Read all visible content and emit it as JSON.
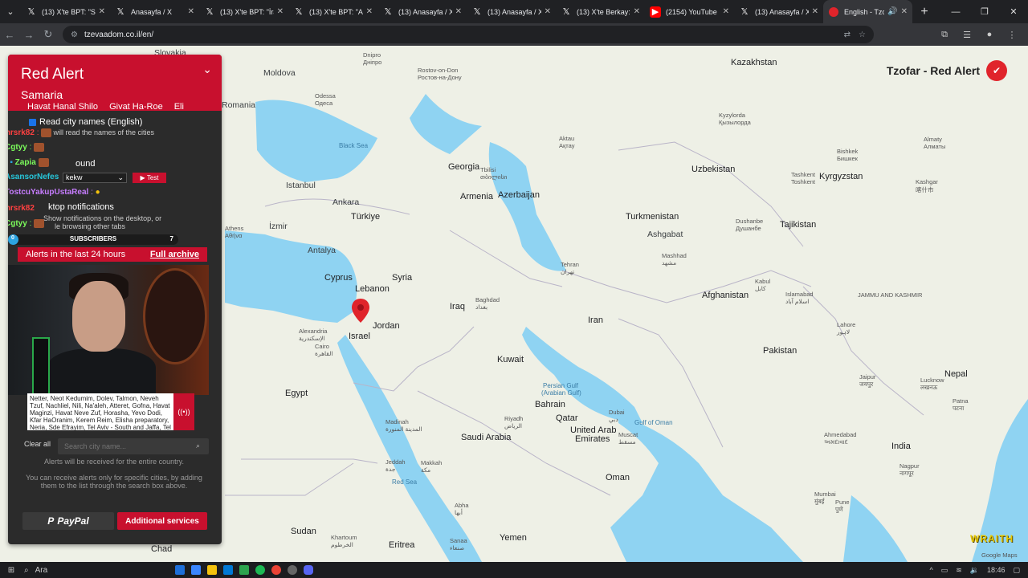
{
  "browser": {
    "tabs": [
      {
        "label": "(13) X'te BPT: \"SO",
        "icon": "x-icon"
      },
      {
        "label": "Anasayfa / X",
        "icon": "x-icon"
      },
      {
        "label": "(13) X'te BPT: \"İra",
        "icon": "x-icon"
      },
      {
        "label": "(13) X'te BPT: \"AB",
        "icon": "x-icon"
      },
      {
        "label": "(13) Anasayfa / X",
        "icon": "x-icon"
      },
      {
        "label": "(13) Anasayfa / X",
        "icon": "x-icon"
      },
      {
        "label": "(13) X'te Berkay: \"",
        "icon": "x-icon"
      },
      {
        "label": "(2154) YouTube",
        "icon": "youtube-icon"
      },
      {
        "label": "(13) Anasayfa / X",
        "icon": "x-icon"
      },
      {
        "label": "English - Tzofa",
        "icon": "tzofar-icon",
        "active": true
      }
    ],
    "url": "tzevaadom.co.il/en/"
  },
  "panel": {
    "title": "Red Alert",
    "region": "Samaria",
    "cities": [
      "Havat Hanal Shilo",
      "Givat Ha-Roe",
      "Eli"
    ],
    "read_names_label": "Read city names (English)",
    "read_names_desc": "rts will read the names of the cities",
    "sound_label": "ound",
    "sound_value": "kekw",
    "test_label": "Test",
    "desktop_label": "ktop notifications",
    "desktop_desc1": "Show notifications on the desktop, or",
    "desktop_desc2": "le browsing other tabs",
    "alerts_24h": "Alerts in the last 24 hours",
    "full_archive": "Full archive",
    "alert_text": "Netter, Neot Kedumim, Dolev, Talmon, Neveh Tzuf, Nachliel, Nili, Na'aleh, Atteret, Gofna, Havat Maginzi, Havat Neve Zuf, Horasha, Yevo Dodi, Kfar HaOranim, Kerem Reim, Elisha preparatory, Neria, Sde Efrayim, Tel Aviv - South and Jaffa, Tel Aviv - East, Azor, Givat",
    "clear_all": "Clear all",
    "search_placeholder": "Search city name...",
    "note1": "Alerts will be received for the entire country.",
    "note2": "You can receive alerts only for specific cities, by adding them to the list through the search box above.",
    "paypal": "PayPal",
    "services": "Additional services"
  },
  "chat": [
    {
      "name": "mrsrk82",
      "text": "",
      "color": "#ff4040"
    },
    {
      "name": "Cgtyy",
      "text": ":",
      "color": "#7cfc5c"
    },
    {
      "name": "Zapia",
      "text": "",
      "color": "#7cfc5c"
    },
    {
      "name": "AsansorNefes",
      "text": ": kekw",
      "color": "#26c6da"
    },
    {
      "name": "TostcuYakupUstaReal",
      "text": ":",
      "color": "#c77dff"
    },
    {
      "name": "mrsrk82",
      "text": "",
      "color": "#ff4040"
    },
    {
      "name": "Cgtyy",
      "text": ":",
      "color": "#7cfc5c"
    }
  ],
  "subs": {
    "label": "SUBSCRIBERS",
    "count": "7",
    "start": "0"
  },
  "brand": {
    "title": "Tzofar - Red Alert"
  },
  "map_labels": {
    "slovakia": "Slovakia",
    "moldova": "Moldova",
    "dnipro": "Dnipro",
    "dnipro_local": "Дніпро",
    "rostov": "Rostov-on-Don",
    "rostov_local": "Ростов-на-Дону",
    "kazakhstan": "Kazakhstan",
    "romania": "Romania",
    "odessa": "Odessa",
    "odessa_local": "Одеса",
    "black_sea": "Black Sea",
    "aktau": "Aktau",
    "aktau_local": "Ақтау",
    "kyzylorda": "Kyzylorda",
    "kyzylorda_local": "Қызылорда",
    "bishkek": "Bishkek",
    "bishkek_local": "Бишкек",
    "almaty": "Almaty",
    "almaty_local": "Алматы",
    "uzbekistan": "Uzbekistan",
    "kyrgyzstan": "Kyrgyzstan",
    "tashkent": "Tashkent",
    "tashkent_local": "Toshkent",
    "kashgar": "Kashgar",
    "kashgar_local": "喀什市",
    "istanbul": "Istanbul",
    "georgia": "Georgia",
    "tbilisi": "Tbilisi",
    "tbilisi_local": "თბილისი",
    "armenia": "Armenia",
    "azerbaijan": "Azerbaijan",
    "ankara": "Ankara",
    "turkiye": "Türkiye",
    "athens": "Athens",
    "athens_local": "Αθήνα",
    "izmir": "İzmir",
    "turkmenistan": "Turkmenistan",
    "ashgabat": "Ashgabat",
    "dushanbe": "Dushanbe",
    "dushanbe_local": "Душанбе",
    "tajikistan": "Tajikistan",
    "antalya": "Antalya",
    "mashhad": "Mashhad",
    "mashhad_local": "مشهد",
    "tehran": "Tehran",
    "tehran_local": "تهران",
    "cyprus": "Cyprus",
    "syria": "Syria",
    "lebanon": "Lebanon",
    "iraq": "Iraq",
    "baghdad": "Baghdad",
    "baghdad_local": "بغداد",
    "afghanistan": "Afghanistan",
    "kabul": "Kabul",
    "kabul_local": "کابل",
    "islamabad": "Islamabad",
    "islamabad_local": "اسلام آباد",
    "jammu": "JAMMU AND KASHMIR",
    "alexandria": "Alexandria",
    "alexandria_local": "الإسكندرية",
    "israel": "Israel",
    "jordan": "Jordan",
    "iran": "Iran",
    "lahore": "Lahore",
    "lahore_local": "لاہور",
    "cairo": "Cairo",
    "cairo_local": "القاهرة",
    "pakistan": "Pakistan",
    "kuwait": "Kuwait",
    "nepal": "Nepal",
    "jaipur": "Jaipur",
    "jaipur_local": "जयपुर",
    "lucknow": "Lucknow",
    "lucknow_local": "लखनऊ",
    "egypt": "Egypt",
    "persian_gulf": "Persian Gulf",
    "persian_gulf_ar": "(Arabian Gulf)",
    "bahrain": "Bahrain",
    "patna": "Patna",
    "patna_local": "पटना",
    "dubai": "Dubai",
    "dubai_local": "دبي",
    "riyadh": "Riyadh",
    "riyadh_local": "الرياض",
    "qatar": "Qatar",
    "medina": "Madinah",
    "medina_local": "المدينة المنورة",
    "uae": "United Arab",
    "uae2": "Emirates",
    "muscat": "Muscat",
    "muscat_local": "مسقط",
    "saudi": "Saudi Arabia",
    "ahmedabad": "Ahmedabad",
    "ahmedabad_local": "અમદાવાદ",
    "gulf_oman": "Gulf of Oman",
    "india": "India",
    "jeddah": "Jeddah",
    "jeddah_local": "جدة",
    "makkah": "Makkah",
    "makkah_local": "مكة",
    "nagpur": "Nagpur",
    "nagpur_local": "नागपूर",
    "red_sea": "Red Sea",
    "oman": "Oman",
    "mumbai": "Mumbai",
    "mumbai_local": "मुंबई",
    "pune": "Pune",
    "pune_local": "पुणे",
    "abha": "Abha",
    "abha_local": "أبها",
    "sudan": "Sudan",
    "khartoum": "Khartoum",
    "khartoum_local": "الخرطوم",
    "yemen": "Yemen",
    "sanaa": "Sanaa",
    "sanaa_local": "صنعاء",
    "chad": "Chad",
    "eritrea": "Eritrea",
    "google_maps": "Google Maps"
  },
  "overlay": {
    "wraith": "WRAITH"
  },
  "taskbar": {
    "search": "Ara",
    "time": "18:46"
  },
  "colors": {
    "alert_red": "#c8102e",
    "water": "#8fd3f2",
    "land": "#eef0e6"
  }
}
